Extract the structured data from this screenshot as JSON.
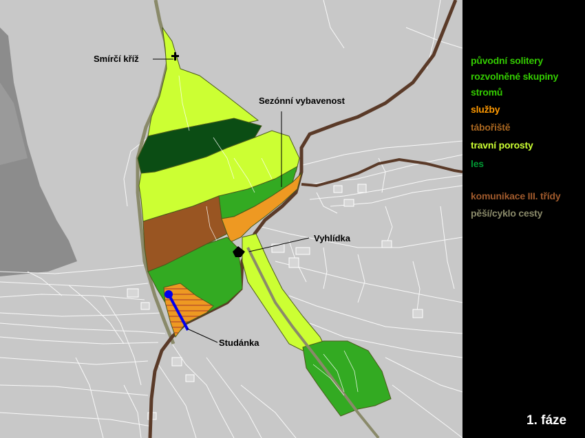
{
  "map": {
    "labels": {
      "smirci_kriz": "Smírčí kříž",
      "sezonni": "Sezónní vybavenost",
      "vyhlidka": "Vyhlídka",
      "studanka": "Studánka"
    }
  },
  "legend": {
    "items": [
      {
        "label": "původní solitery",
        "color": "#33cc00"
      },
      {
        "label": "rozvolněné skupiny",
        "color": "#33cc00"
      },
      {
        "label": "stromů",
        "color": "#33cc00"
      },
      {
        "label": "služby",
        "color": "#ff9900"
      },
      {
        "label": "tábořiště",
        "color": "#a86620"
      },
      {
        "label": "travní porosty",
        "color": "#ccff33"
      },
      {
        "label": "les",
        "color": "#009933"
      },
      {
        "label": "komunikace III. třídy",
        "color": "#a05a2c"
      },
      {
        "label": "pěší/cyklo cesty",
        "color": "#8a8a6a"
      }
    ],
    "phase": "1. fáze"
  },
  "colors": {
    "background": "#c8c8c8",
    "grass": "#ccff33",
    "forest_dark": "#0b4d14",
    "green_group": "#33aa22",
    "services": "#ee9922",
    "camp": "#995522",
    "road": "#5a3a28",
    "path": "#8a8a6a",
    "well_line": "#0000ee"
  }
}
